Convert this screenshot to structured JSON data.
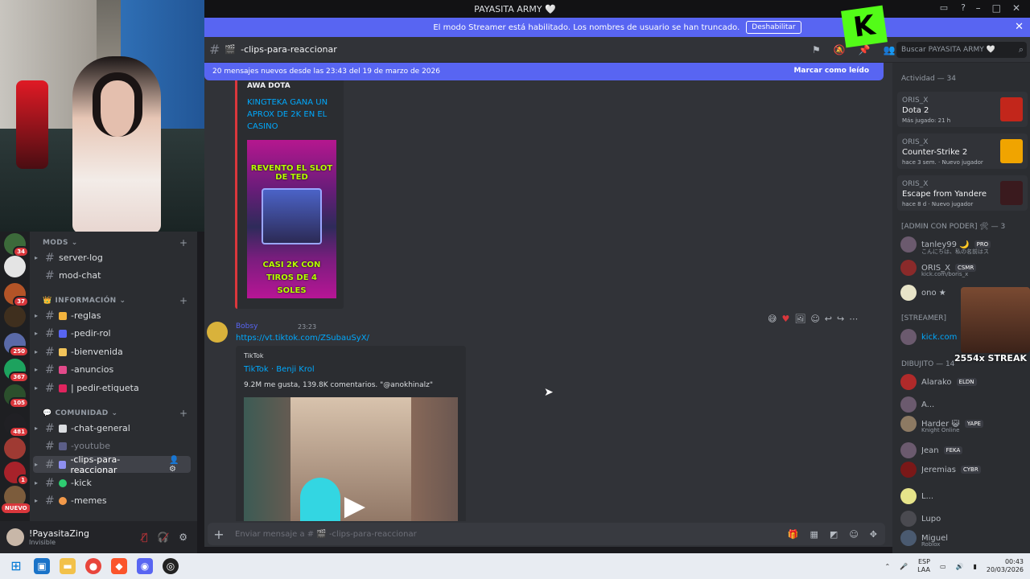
{
  "window": {
    "title": "PAYASITA ARMY 🤍"
  },
  "streamer_banner": {
    "text": "El modo Streamer está habilitado. Los nombres de usuario se han truncado.",
    "button": "Deshabilitar"
  },
  "channel_header": {
    "name": "-clips-para-reaccionar",
    "search_placeholder": "Buscar PAYASITA ARMY 🤍"
  },
  "new_messages": {
    "text": "20 mensajes nuevos desde las 23:43 del 19 de marzo de 2026",
    "mark_read": "Marcar como leído"
  },
  "server_badges": [
    "34",
    "37",
    "250",
    "367",
    "105",
    "481",
    "1"
  ],
  "server_new_label": "NUEVO",
  "categories": {
    "mods": "MODS",
    "info": "INFORMACIÓN",
    "community": "COMUNIDAD"
  },
  "channels": {
    "mods": [
      "server-log",
      "mod-chat"
    ],
    "info": [
      "-reglas",
      "-pedir-rol",
      "-bienvenida",
      "-anuncios",
      "| pedir-etiqueta"
    ],
    "community": [
      "-chat-general",
      "-youtube",
      "-clips-para-reaccionar",
      "-kick",
      "-memes"
    ]
  },
  "user": {
    "name": "!PayasitaZing",
    "status": "Invisible"
  },
  "embed1": {
    "author": "AWA DOTA",
    "title": "KINGTEKA GANA UN APROX DE 2K EN EL CASINO",
    "thumb_top": "REVENTO EL SLOT DE TED",
    "thumb_bottom": "CASI 2K CON TIROS DE 4 SOLES"
  },
  "message": {
    "author": "Bobsy",
    "time": "23:23",
    "link": "https://vt.tiktok.com/ZSubauSyX/",
    "embed_provider": "TikTok",
    "embed_title": "TikTok · Benji Krol",
    "embed_desc": "9.2M me gusta, 139.8K comentarios. \"@anokhinalz\""
  },
  "composer": {
    "placeholder": "Enviar mensaje a # 🎬 -clips-para-reaccionar"
  },
  "members": {
    "activity_header": "Actividad — 34",
    "activities": [
      {
        "user": "ORIS_X",
        "game": "Dota 2",
        "meta": "Más jugado: 21 h",
        "color": "#c2261b"
      },
      {
        "user": "ORIS_X",
        "game": "Counter-Strike 2",
        "meta": "hace 3 sem. · Nuevo jugador",
        "color": "#f0a400"
      },
      {
        "user": "ORIS_X",
        "game": "Escape from Yandere",
        "meta": "hace 8 d · Nuevo jugador",
        "color": "#3a1a1e"
      }
    ],
    "admin_header": "[ADMIN CON PODER] 🛠 — 3",
    "admins": [
      {
        "name": "tanley99 🌙",
        "tag": "PRO",
        "sub": "こんにちは、私の名前はス"
      },
      {
        "name": "ORIS_X",
        "tag": "CSMR",
        "sub": "kick.com/boris_x"
      },
      {
        "name": "ono ★",
        "tag": "",
        "sub": ""
      }
    ],
    "streamer_header": "[STREAMER]",
    "streamer": {
      "name": "kick.com"
    },
    "streak": "2554x STREAK",
    "dibujito_header": "DIBUJITO — 14",
    "dibujito": [
      {
        "name": "Alarako",
        "tag": "ELDN",
        "sub": ""
      },
      {
        "name": "A...",
        "tag": "",
        "sub": ""
      },
      {
        "name": "Harder 😺",
        "tag": "YAPE",
        "sub": "Knight Online"
      },
      {
        "name": "Jean",
        "tag": "FEKA",
        "sub": ""
      },
      {
        "name": "Jeremias",
        "tag": "CYBR",
        "sub": ""
      },
      {
        "name": "L...",
        "tag": "",
        "sub": ""
      },
      {
        "name": "Lupo",
        "tag": "",
        "sub": ""
      },
      {
        "name": "Miguel",
        "tag": "",
        "sub": "Roblox"
      }
    ]
  },
  "taskbar": {
    "lang": "ESP",
    "lang2": "LAA",
    "time": "00:43",
    "date": "20/03/2026"
  }
}
